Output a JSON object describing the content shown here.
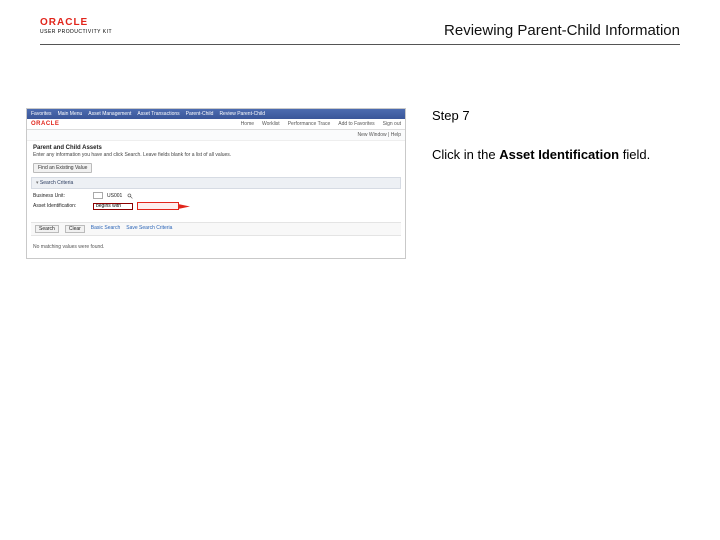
{
  "header": {
    "brand": "ORACLE",
    "sub": "USER PRODUCTIVITY KIT",
    "title": "Reviewing Parent-Child Information"
  },
  "instructions": {
    "step_label": "Step 7",
    "text_pre": "Click in the ",
    "text_bold": "Asset Identification",
    "text_post": " field."
  },
  "screenshot": {
    "topnav": [
      "Favorites",
      "Main Menu",
      "Asset Management",
      "Asset Transactions",
      "Parent-Child",
      "Review Parent-Child"
    ],
    "brand": "ORACLE",
    "tabs": [
      "Home",
      "Worklist",
      "Performance Trace",
      "Add to Favorites",
      "Sign out"
    ],
    "subbar_text": "New Window | Help",
    "page_title": "Parent and Child Assets",
    "page_desc": "Enter any information you have and click Search. Leave fields blank for a list of all values.",
    "find_button": "Find an Existing Value",
    "panel_head": "Search Criteria",
    "bu_label": "Business Unit:",
    "bu_op": "=",
    "bu_value": "US001",
    "aid_label": "Asset Identification:",
    "aid_op": "begins with",
    "aid_value": "",
    "actions": {
      "search": "Search",
      "clear": "Clear",
      "basic": "Basic Search",
      "save": "Save Search Criteria"
    },
    "no_results": "No matching values were found."
  }
}
